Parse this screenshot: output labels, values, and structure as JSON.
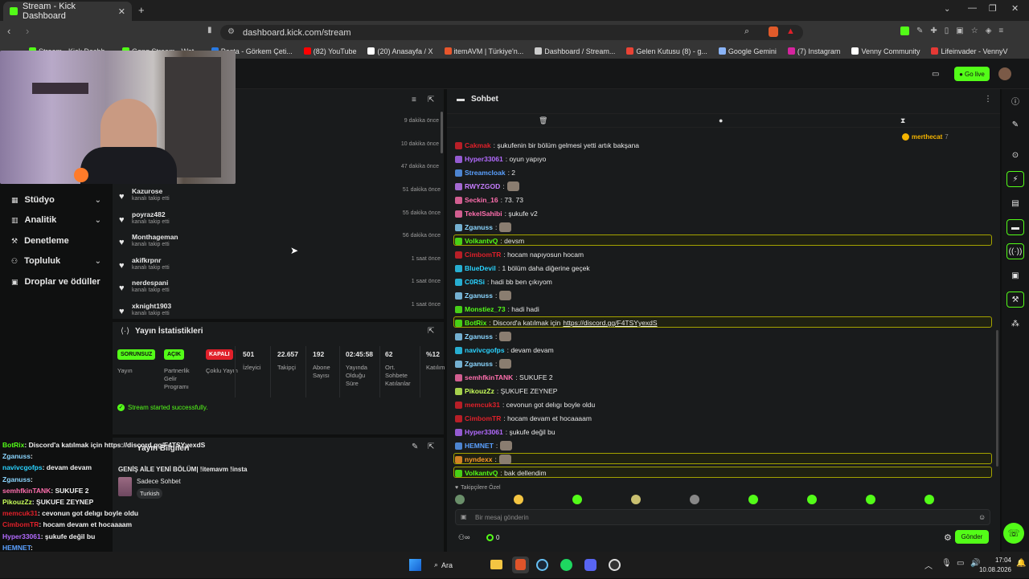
{
  "browser": {
    "tab_title": "Stream - Kick Dashboard",
    "url": "dashboard.kick.com/stream",
    "bookmarks": [
      {
        "label": "Stream - Kick Dashb...",
        "color": "#53fc18"
      },
      {
        "label": "Gong Stream - Wat...",
        "color": "#53fc18"
      },
      {
        "label": "Posta - Görkem Çeti...",
        "color": "#2a7ae2"
      },
      {
        "label": "(82) YouTube",
        "color": "#ff0000"
      },
      {
        "label": "(20) Anasayfa / X",
        "color": "#ffffff"
      },
      {
        "label": "itemAVM | Türkiye'n...",
        "color": "#e8562c"
      },
      {
        "label": "Dashboard / Stream...",
        "color": "#cccccc"
      },
      {
        "label": "Gelen Kutusu (8) - g...",
        "color": "#ea4335"
      },
      {
        "label": "Google Gemini",
        "color": "#8ab4f8"
      },
      {
        "label": "(7) Instagram",
        "color": "#d6249f"
      },
      {
        "label": "Venny Community",
        "color": "#ffffff"
      },
      {
        "label": "Lifeinvader - VennyV",
        "color": "#e53935"
      }
    ]
  },
  "header": {
    "golive_label": "Go live"
  },
  "sidebar": {
    "items": [
      {
        "label": "Stüdyo",
        "icon": "studio-icon",
        "chevron": true
      },
      {
        "label": "Analitik",
        "icon": "analytics-icon",
        "chevron": true
      },
      {
        "label": "Denetleme",
        "icon": "wrench-icon",
        "chevron": false
      },
      {
        "label": "Topluluk",
        "icon": "community-icon",
        "chevron": true
      },
      {
        "label": "Droplar ve ödüller",
        "icon": "gift-icon",
        "chevron": false
      }
    ]
  },
  "activity": {
    "hidden_times": [
      "9 dakika önce",
      "10 dakika önce",
      "47 dakika önce"
    ],
    "rows": [
      {
        "user": "Kazurose",
        "sub": "kanalı takip etti",
        "time": "51 dakika önce"
      },
      {
        "user": "poyraz482",
        "sub": "kanalı takip etti",
        "time": "55 dakika önce"
      },
      {
        "user": "Monthageman",
        "sub": "kanalı takip etti",
        "time": "56 dakika önce"
      },
      {
        "user": "akifkrpnr",
        "sub": "kanalı takip etti",
        "time": "1 saat önce"
      },
      {
        "user": "nerdespani",
        "sub": "kanalı takip etti",
        "time": "1 saat önce"
      },
      {
        "user": "xknight1903",
        "sub": "kanalı takip etti",
        "time": "1 saat önce"
      }
    ]
  },
  "stats": {
    "title": "Yayın İstatistikleri",
    "badges": [
      {
        "badge": "SORUNSUZ",
        "label": "Yayın",
        "color": "#53fc18",
        "text": "#111"
      },
      {
        "badge": "AÇIK",
        "label": "Partnerlik Gelir Programı",
        "color": "#53fc18",
        "text": "#111"
      },
      {
        "badge": "KAPALI",
        "label": "Çoklu Yayın",
        "color": "#e0202a",
        "text": "#fff"
      }
    ],
    "values": [
      {
        "value": "501",
        "label": "İzleyici"
      },
      {
        "value": "22.657",
        "label": "Takipçi"
      },
      {
        "value": "192",
        "label": "Abone Sayısı"
      },
      {
        "value": "02:45:58",
        "label": "Yayında Olduğu Süre"
      },
      {
        "value": "62",
        "label": "Ort. Sohbete Katılanlar"
      },
      {
        "value": "%12",
        "label": "Katılım"
      }
    ],
    "success_msg": "Stream started successfully."
  },
  "info": {
    "title": "Yayın Bilgileri",
    "stream_title": "GENİŞ AİLE YENİ BÖLÜM| !itemavm !insta",
    "category": "Sadece Sohbet",
    "tag": "Turkish"
  },
  "chat": {
    "title": "Sohbet",
    "pinned_user": "merthecat",
    "pinned_count": "7",
    "messages": [
      {
        "user": "Cakmak",
        "text": ": şukufenin bir bölüm gelmesi yetti artık bakşana",
        "color": "#e0202a"
      },
      {
        "user": "Hyper33061",
        "text": ": oyun yapıyo",
        "color": "#b36bff"
      },
      {
        "user": "Streamcloak",
        "text": ": 2",
        "color": "#5aa0ff"
      },
      {
        "user": "RWYZGOD",
        "text": ":",
        "color": "#c77dff",
        "emote": true
      },
      {
        "user": "Seckin_16",
        "text": ": 73. 73",
        "color": "#ff6fae"
      },
      {
        "user": "TekelSahibi",
        "text": ": şukufe v2",
        "color": "#ff6fae"
      },
      {
        "user": "Zganuss",
        "text": ":",
        "color": "#8bd6ff",
        "emote": true
      },
      {
        "user": "VolkantvQ",
        "text": ": devsm",
        "color": "#53fc18",
        "highlight": true
      },
      {
        "user": "CimbomTR",
        "text": ": hocam napıyosun hocam",
        "color": "#e0202a"
      },
      {
        "user": "BlueDevil",
        "text": ": 1 bölüm daha diğerine geçek",
        "color": "#2ad3ff"
      },
      {
        "user": "C0RSi",
        "text": ": hadi bb ben çıkıyom",
        "color": "#2ad3ff"
      },
      {
        "user": "Zganuss",
        "text": ":",
        "color": "#8bd6ff",
        "emote": true
      },
      {
        "user": "Monstiez_73",
        "text": ": hadi hadi",
        "color": "#53fc18"
      },
      {
        "user": "BotRix",
        "text": ": Discord'a katılmak için ",
        "link": "https://discord.gg/F4TSYyexdS",
        "color": "#53fc18",
        "highlight": true
      },
      {
        "user": "Zganuss",
        "text": ":",
        "color": "#8bd6ff",
        "emote": true
      },
      {
        "user": "navivcgofps",
        "text": ": devam devam",
        "color": "#2ad3ff"
      },
      {
        "user": "Zganuss",
        "text": ":",
        "color": "#8bd6ff",
        "emote": true
      },
      {
        "user": "semhfkinTANK",
        "text": ": SUKUFE 2",
        "color": "#ff6fae"
      },
      {
        "user": "PikouzZz",
        "text": ": ŞUKUFE ZEYNEP",
        "color": "#c9ff5a"
      },
      {
        "user": "memcuk31",
        "text": ": cevonun got delıgı boyle oldu",
        "color": "#e0202a"
      },
      {
        "user": "CimbomTR",
        "text": ": hocam devam et hocaaaam",
        "color": "#e0202a"
      },
      {
        "user": "Hyper33061",
        "text": ": şukufe değil bu",
        "color": "#b36bff"
      },
      {
        "user": "HEMNET",
        "text": ":",
        "color": "#5aa0ff",
        "emote": true
      },
      {
        "user": "nyndexx",
        "text": ":",
        "color": "#ff9b2a",
        "emote": true,
        "highlight": true
      },
      {
        "user": "VolkantvQ",
        "text": ": bak dellendim",
        "color": "#53fc18",
        "highlight": true
      }
    ],
    "followers_label": "Takipçilere Özel",
    "input_placeholder": "Bir mesaj gönderin",
    "points": "0",
    "send_label": "Gönder"
  },
  "overlay_chat": [
    {
      "user": "BotRix",
      "text": ": Discord'a katılmak için https://discord.gg/F4TSYyexdS",
      "color": "#53fc18"
    },
    {
      "user": "Zganuss",
      "text": ":",
      "color": "#8bd6ff"
    },
    {
      "user": "navivcgofps",
      "text": ": devam devam",
      "color": "#2ad3ff"
    },
    {
      "user": "Zganuss",
      "text": ":",
      "color": "#8bd6ff"
    },
    {
      "user": "semhfkinTANK",
      "text": ": SUKUFE 2",
      "color": "#ff6fae"
    },
    {
      "user": "PikouzZz",
      "text": ": ŞUKUFE ZEYNEP",
      "color": "#c9ff5a"
    },
    {
      "user": "memcuk31",
      "text": ": cevonun got delıgı boyle oldu",
      "color": "#e0202a"
    },
    {
      "user": "CimbomTR",
      "text": ": hocam devam et hocaaaam",
      "color": "#e0202a"
    },
    {
      "user": "Hyper33061",
      "text": ": şukufe değil bu",
      "color": "#b36bff"
    },
    {
      "user": "HEMNET",
      "text": ":",
      "color": "#5aa0ff"
    },
    {
      "user": "nyndexx",
      "text": ":",
      "color": "#ff9b2a"
    },
    {
      "user": "VolkantvQ",
      "text": ": bak dellendim",
      "color": "#53fc18"
    }
  ],
  "taskbar": {
    "search_label": "Ara",
    "time": "17:04",
    "date": "10.08.2026"
  }
}
